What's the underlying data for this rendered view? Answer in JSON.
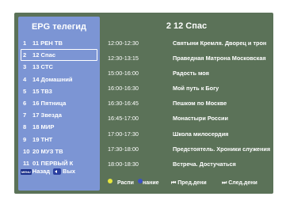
{
  "sidebar": {
    "title": "EPG телегид",
    "channels": [
      {
        "num": "1",
        "name": "11 РЕН ТВ"
      },
      {
        "num": "2",
        "name": "12 Спас"
      },
      {
        "num": "3",
        "name": "13 СТС"
      },
      {
        "num": "4",
        "name": "14 Домашний"
      },
      {
        "num": "5",
        "name": "15 ТВ3"
      },
      {
        "num": "6",
        "name": "16 Пятница"
      },
      {
        "num": "7",
        "name": "17 Звезда"
      },
      {
        "num": "8",
        "name": "18 МИР"
      },
      {
        "num": "9",
        "name": "19 ТНТ"
      },
      {
        "num": "10",
        "name": "20 МУЗ ТВ"
      },
      {
        "num": "11",
        "name": "01 ПЕРВЫЙ К"
      }
    ],
    "selected_index": 1,
    "footer": {
      "menu_icon": "MENU",
      "back_label": "Назад",
      "exit_label": "Вых"
    }
  },
  "panel": {
    "title": "2  12 Спас",
    "programs": [
      {
        "time": "12:00-12:30",
        "title": "Святыни Кремля. Дворец и трон"
      },
      {
        "time": "12:30-13:15",
        "title": "Праведная Матрона Московская"
      },
      {
        "time": "15:00-16:00",
        "title": "Радость моя"
      },
      {
        "time": "16:00-16:30",
        "title": "Мой путь к Богу"
      },
      {
        "time": "16:30-16:45",
        "title": "Пешком по Москве"
      },
      {
        "time": "16:45-17:00",
        "title": "Монастыри России"
      },
      {
        "time": "17:00-17:30",
        "title": "Школа милосердия"
      },
      {
        "time": "17:30-18:00",
        "title": "Предстоятель. Хроники служения"
      },
      {
        "time": "18:00-18:30",
        "title": "Встреча. Достучаться"
      }
    ],
    "legend": {
      "yellow_label": "Распи",
      "blue_label": "нание",
      "prev_label": "⏮ Пред.дени",
      "next_label": "⏭ След.дени"
    }
  },
  "colors": {
    "screen_bg": "#5b7258",
    "sidebar_bg": "#7c95d4",
    "yellow_dot": "#e6e63c",
    "blue_dot": "#3c50c8"
  }
}
